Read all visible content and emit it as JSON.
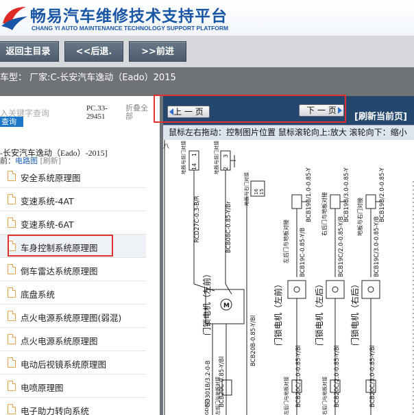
{
  "header": {
    "title": "畅易汽车维修技术支持平台",
    "subtitle": "CHANG YI AUTO MAINTENANCE TECHNOLOGY SUPPORT PLATFORM",
    "brand_color": "#1a56a6"
  },
  "nav": {
    "home": "返回主目录",
    "back": "<<后退.",
    "forward": ">>前进"
  },
  "model_bar": "车型：  厂家:C-长安汽车逸动（Eado）2015",
  "left": {
    "search_placeholder": "入关键字查询",
    "search_button": "查询",
    "code_line1": "PC.33-",
    "code_line2": "29451",
    "collapse_line1": "折叠全",
    "collapse_line2": "部",
    "tree_header": "-长安汽车逸动（Eado）-2015]",
    "current_prefix": "前：",
    "current_value": "电路图",
    "current_refresh": "[刷新]",
    "items": [
      {
        "label": "安全系统原理图"
      },
      {
        "label": "变速系统-4AT"
      },
      {
        "label": "变速系统-6AT"
      },
      {
        "label": "车身控制系统原理图"
      },
      {
        "label": "倒车雷达系统原理图"
      },
      {
        "label": "底盘系统"
      },
      {
        "label": "点火电源系统原理图(弱混)"
      },
      {
        "label": "点火电源系统原理图"
      },
      {
        "label": "电动后视镜系统原理图"
      },
      {
        "label": "电喷原理图"
      },
      {
        "label": "电子助力转向系统"
      }
    ]
  },
  "toolbar": {
    "prev": "上 一 页",
    "next": "下 一 页",
    "refresh": "[刷新当前页]"
  },
  "hint": "鼠标左右拖动：控制图片位置  鼠标滚轮向上:放大   滚轮向下：缩小",
  "diagram": {
    "motors": [
      "门锁电机（左前）",
      "门锁电机（左前）",
      "门锁电机（左后）",
      "门锁电机（右后）"
    ],
    "wire_codes": [
      "RCD27C-0.3-B/R",
      "BCB08C-0.85-Y/Br",
      "BCB19C-0.85-Y/B",
      "BCB19B/1.0-0.85-Y",
      "BCB19C/2.0-0.85-Y/B",
      "BCB19B/3.0-0.85-Y",
      "BCB19C/3.0-0.85-Y/B",
      "BCB19B/2.0-0.85-Y",
      "GD301B/3.2-0-B",
      "BCB20C-0.85-Y/Bl",
      "BCB20B-0.85-Y/Bl",
      "BCB20C/1.0-0.85-Y/Bl",
      "BCB20C/2.0-0.85-Y/Bl",
      "BCB20C/3.0-0.85-Y/Bl"
    ],
    "connector_labels": [
      "地板与前门对接",
      "地板与前门对接",
      "左后门与地板对接",
      "左后门与地板对接",
      "右后门与地板对接",
      "右后门与地板对接",
      "地板与右门对接",
      "地板与右门对接",
      "左前门与地板对接"
    ],
    "pin_labels": [
      "1",
      "14",
      "2",
      "3",
      "15",
      "16",
      "4",
      "5",
      "M"
    ],
    "misc": [
      "GD301",
      "左前门与地板对接",
      "BCB20C",
      "0.85 Y/Bl"
    ]
  }
}
